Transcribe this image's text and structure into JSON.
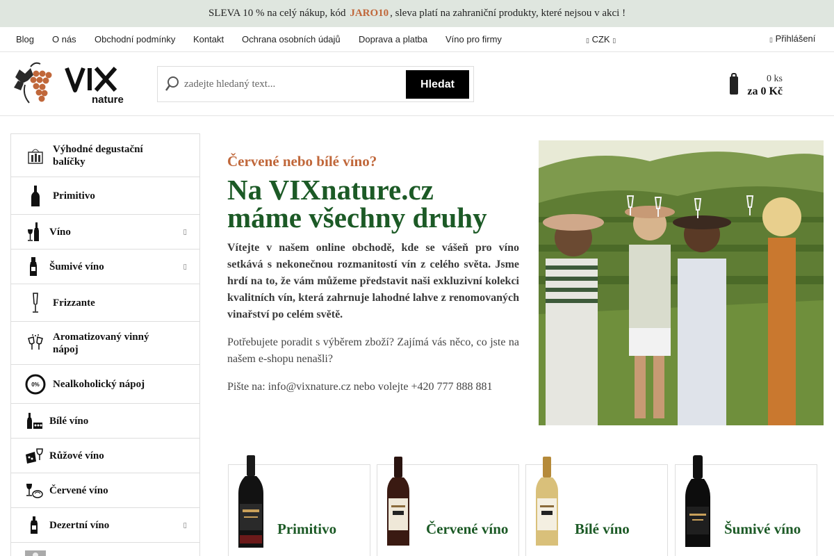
{
  "promo": {
    "before": "SLEVA 10 % na celý nákup, kód",
    "code": "JARO10",
    "after": ", sleva platí na zahraniční produkty, které nejsou v akci !"
  },
  "topnav": {
    "links": [
      "Blog",
      "O nás",
      "Obchodní podmínky",
      "Kontakt",
      "Ochrana osobních údajů",
      "Doprava a platba",
      "Víno pro firmy"
    ],
    "currency": "CZK",
    "login": "Přihlášení"
  },
  "search": {
    "placeholder": "zadejte hledaný text...",
    "button": "Hledat"
  },
  "cart": {
    "quantity": "0 ks",
    "total": "za 0 Kč"
  },
  "sidebar": {
    "items": [
      {
        "label": "Výhodné degustační balíčky",
        "icon": "gift-box-icon",
        "has_submenu": false
      },
      {
        "label": "Primitivo",
        "icon": "bottle-icon",
        "has_submenu": false
      },
      {
        "label": "Víno",
        "icon": "wine-glass-bottle-icon",
        "has_submenu": true
      },
      {
        "label": "Šumivé víno",
        "icon": "sparkling-bottle-icon",
        "has_submenu": true
      },
      {
        "label": "Frizzante",
        "icon": "flute-glass-icon",
        "has_submenu": false
      },
      {
        "label": "Aromatizovaný vinný nápoj",
        "icon": "toast-glasses-icon",
        "has_submenu": false
      },
      {
        "label": "Nealkoholický nápoj",
        "icon": "zero-percent-icon",
        "badge": "0%",
        "has_submenu": false
      },
      {
        "label": "Bílé víno",
        "icon": "white-wine-icon",
        "has_submenu": false
      },
      {
        "label": "Růžové víno",
        "icon": "rose-wine-icon",
        "has_submenu": false
      },
      {
        "label": "Červené víno",
        "icon": "red-wine-icon",
        "has_submenu": false
      },
      {
        "label": "Dezertní víno",
        "icon": "dessert-wine-icon",
        "has_submenu": true
      }
    ]
  },
  "hero": {
    "kicker": "Červené nebo bílé víno?",
    "title_line1": "Na VIXnature.cz",
    "title_line2": "máme všechny druhy",
    "intro": "Vítejte v našem online obchodě, kde se vášeň pro víno setkává s nekonečnou rozmanitostí vín z celého světa. Jsme hrdí na to, že vám můžeme představit naši exkluzivní kolekci kvalitních vín, která zahrnuje lahodné lahve z renomovaných vinařství po celém světě.",
    "help": "Potřebujete poradit s výběrem zboží? Zajímá vás něco, co jste na našem e-shopu nenašli?",
    "contact": "Pište na: info@vixnature.cz nebo volejte +420 777 888 881"
  },
  "categories": [
    {
      "label": "Primitivo",
      "bottle": "dark"
    },
    {
      "label": "Červené víno",
      "bottle": "red"
    },
    {
      "label": "Bílé víno",
      "bottle": "white"
    },
    {
      "label": "Šumivé víno",
      "bottle": "sparkling"
    }
  ],
  "colors": {
    "accent": "#c0673a",
    "heading_green": "#1c5a26",
    "promo_bg": "#dfe6df"
  }
}
